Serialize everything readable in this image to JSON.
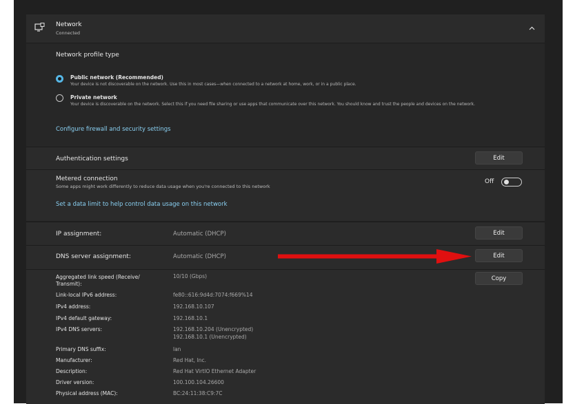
{
  "header": {
    "title": "Network",
    "status": "Connected",
    "icon": "monitor-network-icon",
    "chevron": "chevron-up-icon"
  },
  "profile": {
    "heading": "Network profile type",
    "public_title": "Public network (Recommended)",
    "public_desc": "Your device is not discoverable on the network. Use this in most cases—when connected to a network at home, work, or in a public place.",
    "private_title": "Private network",
    "private_desc": "Your device is discoverable on the network. Select this if you need file sharing or use apps that communicate over this network. You should know and trust the people and devices on the network.",
    "firewall_link": "Configure firewall and security settings",
    "selected": "public"
  },
  "auth": {
    "label": "Authentication settings",
    "edit": "Edit"
  },
  "metered": {
    "title": "Metered connection",
    "desc": "Some apps might work differently to reduce data usage when you're connected to this network",
    "state": "Off",
    "link": "Set a data limit to help control data usage on this network"
  },
  "ip": {
    "label": "IP assignment:",
    "value": "Automatic (DHCP)",
    "edit": "Edit"
  },
  "dns": {
    "label": "DNS server assignment:",
    "value": "Automatic (DHCP)",
    "edit": "Edit"
  },
  "properties": {
    "copy": "Copy",
    "rows": [
      {
        "label": "Aggregated link speed (Receive/",
        "label2": "Transmit):",
        "value": "10/10 (Gbps)"
      },
      {
        "label": "Link-local IPv6 address:",
        "value": "fe80::616:9d4d:7074:f669%14"
      },
      {
        "label": "IPv4 address:",
        "value": "192.168.10.107"
      },
      {
        "label": "IPv4 default gateway:",
        "value": "192.168.10.1"
      },
      {
        "label": "IPv4 DNS servers:",
        "value": "192.168.10.204 (Unencrypted)",
        "value2": "192.168.10.1 (Unencrypted)"
      },
      {
        "label": "Primary DNS suffix:",
        "value": "lan"
      },
      {
        "label": "Manufacturer:",
        "value": "Red Hat, Inc."
      },
      {
        "label": "Description:",
        "value": "Red Hat VirtIO Ethernet Adapter"
      },
      {
        "label": "Driver version:",
        "value": "100.100.104.26600"
      },
      {
        "label": "Physical address (MAC):",
        "value": "BC:24:11:38:C9:7C"
      }
    ]
  },
  "annotation": {
    "arrow_color": "#e01010"
  },
  "colors": {
    "accent": "#56b7e6",
    "link": "#8ad0f2",
    "panel": "#2b2b2b"
  }
}
